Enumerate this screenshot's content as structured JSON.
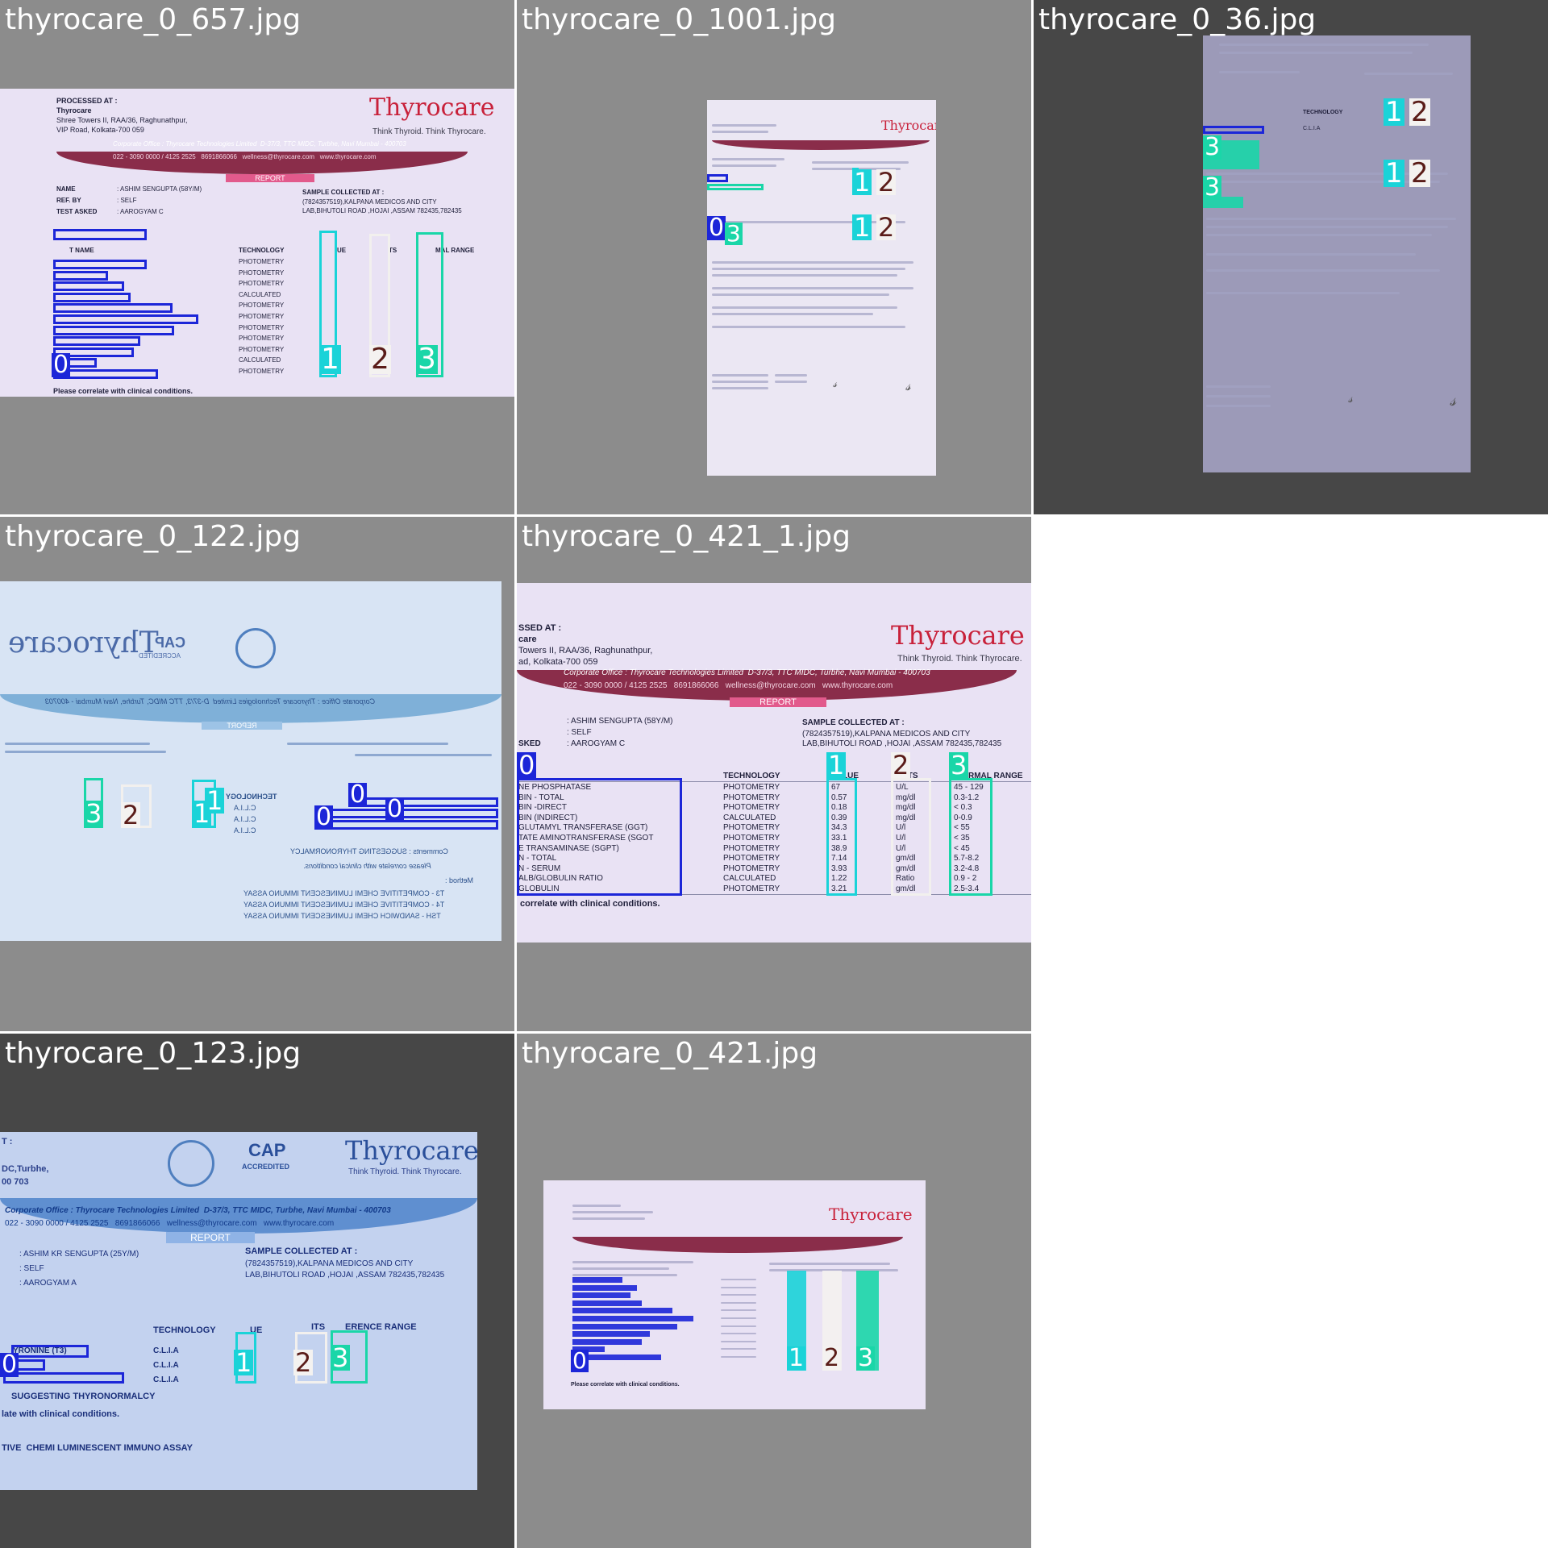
{
  "grid": {
    "background": "#ffffff",
    "tile_background": "#8c8c8c",
    "tile_background_dark": "#474747"
  },
  "classes": {
    "c0": "#1c26d8",
    "c1": "#1ad3d8",
    "c2": "#f4f2f0",
    "c3": "#1ad6a8"
  },
  "tiles": [
    {
      "title": "thyrocare_0_657.jpg",
      "doc": {
        "processed_at": "PROCESSED AT :",
        "processed_name": "Thyrocare",
        "address_1": "Shree Towers II, RAA/36, Raghunathpur,",
        "address_2": "VIP Road, Kolkata-700 059",
        "brand": "Thyrocare",
        "tagline": "Think Thyroid. Think Thyrocare.",
        "corporate": "Corporate Office : Thyrocare Technologies Limited  D-37/3, TTC MIDC, Turbhe, Navi Mumbai - 400703",
        "contact": "022 - 3090 0000 / 4125 2525   8691866066   wellness@thyrocare.com   www.thyrocare.com",
        "report": "REPORT",
        "name_label": "NAME",
        "name_value": ": ASHIM SENGUPTA (58Y/M)",
        "ref_label": "REF. BY",
        "ref_value": ": SELF",
        "test_label": "TEST ASKED",
        "test_value": ": AAROGYAM C",
        "sample_label": "SAMPLE COLLECTED AT :",
        "sample_1": "(7824357519),KALPANA MEDICOS AND CITY",
        "sample_2": "LAB,BIHUTOLI ROAD ,HOJAI ,ASSAM 782435,782435",
        "col_name": "T NAME",
        "col_tech": "TECHNOLOGY",
        "col_value": "UE",
        "col_units": "TS",
        "col_range": "MAL RANGE",
        "tech_rows": [
          "PHOTOMETRY",
          "PHOTOMETRY",
          "PHOTOMETRY",
          "CALCULATED",
          "PHOTOMETRY",
          "PHOTOMETRY",
          "PHOTOMETRY",
          "PHOTOMETRY",
          "PHOTOMETRY",
          "CALCULATED",
          "PHOTOMETRY"
        ],
        "footer": "Please correlate with clinical conditions."
      },
      "labels": [
        "0",
        "1",
        "2",
        "3"
      ]
    },
    {
      "title": "thyrocare_0_1001.jpg",
      "doc": {
        "brand": "Thyrocar"
      },
      "labels": [
        "1",
        "2",
        "1",
        "2",
        "0",
        "3"
      ]
    },
    {
      "title": "thyrocare_0_36.jpg",
      "doc": {
        "col_tech": "TECHNOLOGY",
        "tech_value": "C.L.I.A"
      },
      "labels": [
        "1",
        "2",
        "3",
        "1",
        "2",
        "3"
      ]
    },
    {
      "title": "thyrocare_0_122.jpg",
      "doc": {
        "brand_mirrored": "Thyrocare",
        "cap": "CAP",
        "accredited": "ACCREDITED",
        "corporate": "Corporate Office : Thyrocare Technologies Limited  D-37/3, TTC MIDC, Turbhe, Navi Mumbai - 400703",
        "report": "REPORT",
        "tech_header": "TECHNOLOGY",
        "tech_rows": [
          "C.L.I.A",
          "C.L.I.A",
          "C.L.I.A"
        ],
        "comments": "Comments : SUGGESTING THYRONORMALCY",
        "correlate": "Please correlate with clinical conditions.",
        "method": "Method :",
        "m1": "T3 - COMPETITIVE CHEMI LUMINESCENT IMMUNO ASSAY",
        "m2": "T4 - COMPETITIVE CHEMI LUMINESCENT IMMUNO ASSAY",
        "m3": "TSH - SANDWICH CHEMI LUMINESCENT IMMUNO ASSAY"
      },
      "labels": [
        "3",
        "2",
        "1",
        "1",
        "0",
        "0",
        "0"
      ]
    },
    {
      "title": "thyrocare_0_421_1.jpg",
      "doc": {
        "processed_at": "SSED AT :",
        "processed_name": "care",
        "address_1": "Towers II, RAA/36, Raghunathpur,",
        "address_2": "ad, Kolkata-700 059",
        "brand": "Thyrocare",
        "tagline": "Think Thyroid. Think Thyrocare.",
        "corporate": "Corporate Office : Thyrocare Technologies Limited  D-37/3, TTC MIDC, Turbhe, Navi Mumbai - 400703",
        "contact": "022 - 3090 0000 / 4125 2525   8691866066   wellness@thyrocare.com   www.thyrocare.com",
        "report": "REPORT",
        "name_value": ": ASHIM SENGUPTA (58Y/M)",
        "ref_value": ": SELF",
        "test_label": "SKED",
        "test_value": ": AAROGYAM C",
        "sample_label": "SAMPLE COLLECTED AT :",
        "sample_1": "(7824357519),KALPANA MEDICOS AND CITY",
        "sample_2": "LAB,BIHUTOLI ROAD ,HOJAI ,ASSAM 782435,782435",
        "col_name": "ME",
        "col_tech": "TECHNOLOGY",
        "col_value": "LUE",
        "col_units": "ITS",
        "col_range": "RMAL RANGE",
        "rows": [
          {
            "name": "NE PHOSPHATASE",
            "tech": "PHOTOMETRY",
            "value": "67",
            "unit": "U/L",
            "range": "45 - 129"
          },
          {
            "name": "BIN - TOTAL",
            "tech": "PHOTOMETRY",
            "value": "0.57",
            "unit": "mg/dl",
            "range": "0.3-1.2"
          },
          {
            "name": "BIN -DIRECT",
            "tech": "PHOTOMETRY",
            "value": "0.18",
            "unit": "mg/dl",
            "range": "< 0.3"
          },
          {
            "name": "BIN (INDIRECT)",
            "tech": "CALCULATED",
            "value": "0.39",
            "unit": "mg/dl",
            "range": "0-0.9"
          },
          {
            "name": "GLUTAMYL TRANSFERASE (GGT)",
            "tech": "PHOTOMETRY",
            "value": "34.3",
            "unit": "U/l",
            "range": "< 55"
          },
          {
            "name": "TATE AMINOTRANSFERASE (SGOT",
            "tech": "PHOTOMETRY",
            "value": "33.1",
            "unit": "U/l",
            "range": "< 35"
          },
          {
            "name": "E TRANSAMINASE (SGPT)",
            "tech": "PHOTOMETRY",
            "value": "38.9",
            "unit": "U/l",
            "range": "< 45"
          },
          {
            "name": "N - TOTAL",
            "tech": "PHOTOMETRY",
            "value": "7.14",
            "unit": "gm/dl",
            "range": "5.7-8.2"
          },
          {
            "name": "N - SERUM",
            "tech": "PHOTOMETRY",
            "value": "3.93",
            "unit": "gm/dl",
            "range": "3.2-4.8"
          },
          {
            "name": "ALB/GLOBULIN RATIO",
            "tech": "CALCULATED",
            "value": "1.22",
            "unit": "Ratio",
            "range": "0.9 - 2"
          },
          {
            "name": "GLOBULIN",
            "tech": "PHOTOMETRY",
            "value": "3.21",
            "unit": "gm/dl",
            "range": "2.5-3.4"
          }
        ],
        "footer": "correlate with clinical conditions."
      },
      "labels": [
        "0",
        "1",
        "2",
        "3"
      ]
    },
    {
      "title": "thyrocare_0_123.jpg",
      "doc": {
        "left_1": "T :",
        "left_2": "DC,Turbhe,",
        "left_3": "00 703",
        "cap": "CAP",
        "accredited": "ACCREDITED",
        "brand": "Thyrocare",
        "tagline": "Think Thyroid. Think Thyrocare.",
        "corporate": "Corporate Office : Thyrocare Technologies Limited  D-37/3, TTC MIDC, Turbhe, Navi Mumbai - 400703",
        "contact": "022 - 3090 0000 / 4125 2525   8691866066   wellness@thyrocare.com   www.thyrocare.com",
        "report": "REPORT",
        "name_value": ": ASHIM KR SENGUPTA (25Y/M)",
        "ref_value": ": SELF",
        "test_value": ": AAROGYAM A",
        "sample_label": "SAMPLE COLLECTED AT :",
        "sample_1": "(7824357519),KALPANA MEDICOS AND CITY",
        "sample_2": "LAB,BIHUTOLI ROAD ,HOJAI ,ASSAM 782435,782435",
        "col_tech": "TECHNOLOGY",
        "col_value": "UE",
        "col_units": "ITS",
        "col_range": "ERENCE RANGE",
        "row_1": "YRONINE (T3)",
        "tech_rows": [
          "C.L.I.A",
          "C.L.I.A",
          "C.L.I.A"
        ],
        "comments": "SUGGESTING THYRONORMALCY",
        "correlate": "late with clinical conditions.",
        "method": "TIVE  CHEMI LUMINESCENT IMMUNO ASSAY"
      },
      "labels": [
        "0",
        "1",
        "2",
        "3"
      ]
    },
    {
      "title": "thyrocare_0_421.jpg",
      "doc": {
        "brand": "Thyrocare",
        "footer": "Please correlate with clinical conditions."
      },
      "labels": [
        "0",
        "1",
        "2",
        "3"
      ]
    }
  ]
}
